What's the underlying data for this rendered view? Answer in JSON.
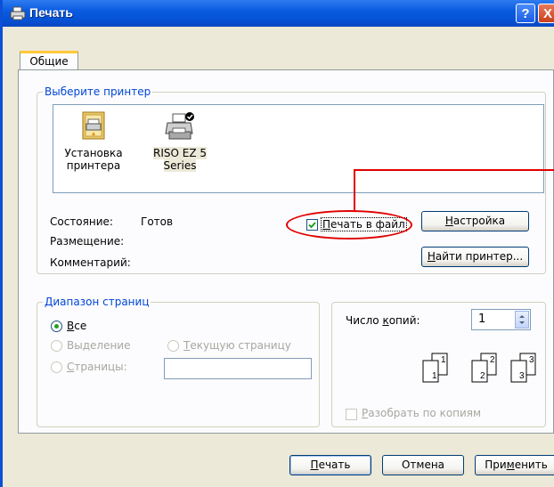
{
  "window": {
    "title": "Печать",
    "help_label": "?",
    "close_label": "X"
  },
  "tabs": [
    {
      "label": "Общие",
      "active": true
    }
  ],
  "printer_group": {
    "legend": "Выберите принтер",
    "printers": [
      {
        "name_line1": "Установка",
        "name_line2": "принтера",
        "icon": "add-printer-icon",
        "selected": false
      },
      {
        "name_line1": "RISO EZ 5",
        "name_line2": "Series",
        "icon": "printer-icon",
        "selected": true
      }
    ],
    "status_label": "Состояние:",
    "status_value": "Готов",
    "location_label": "Размещение:",
    "comment_label": "Комментарий:",
    "print_to_file": {
      "pre": "",
      "accel": "П",
      "post": "ечать в файл",
      "checked": true
    },
    "settings_button": {
      "pre": "",
      "accel": "Н",
      "post": "астройка"
    },
    "find_printer_button": {
      "pre": "",
      "accel": "Н",
      "post": "айти принтер..."
    }
  },
  "page_range": {
    "legend": "Диапазон страниц",
    "all": {
      "pre": "",
      "accel": "В",
      "post": "се",
      "selected": true
    },
    "selection": {
      "pre": "Вы",
      "accel": "д",
      "post": "еление",
      "enabled": false
    },
    "current_page": {
      "pre": "",
      "accel": "Т",
      "post": "екущую страницу",
      "enabled": false
    },
    "pages": {
      "pre": "",
      "accel": "С",
      "post": "траницы:",
      "enabled": false
    },
    "pages_value": ""
  },
  "copies": {
    "label_pre": "Число ",
    "label_accel": "к",
    "label_post": "опий:",
    "value": "1",
    "collate": {
      "pre": "",
      "accel": "Р",
      "post": "азобрать по копиям",
      "checked": false,
      "enabled": false
    },
    "collate_icon_pages": [
      "1",
      "1",
      "2",
      "2",
      "3",
      "3"
    ]
  },
  "buttons": {
    "print": {
      "pre": "",
      "accel": "П",
      "post": "ечать"
    },
    "cancel": {
      "label": "Отмена"
    },
    "apply": {
      "pre": "При",
      "accel": "м",
      "post": "енить"
    }
  },
  "colors": {
    "accent": "#0a5ce0",
    "legend": "#0046d5",
    "annotation": "#e00000"
  }
}
